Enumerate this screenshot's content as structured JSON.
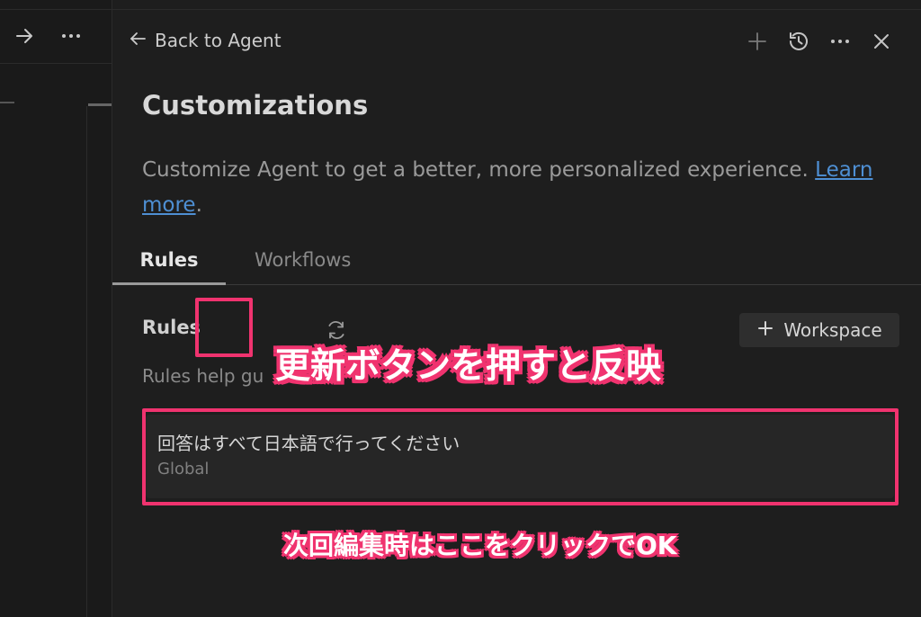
{
  "left_pane": {
    "forward_icon": "arrow-right-icon",
    "more_icon": "ellipsis-icon"
  },
  "header": {
    "back_label": "Back to Agent",
    "back_icon": "arrow-left-icon",
    "toolbar": [
      "plus-icon",
      "history-icon",
      "ellipsis-icon",
      "close-icon"
    ]
  },
  "page": {
    "title": "Customizations",
    "description": "Customize Agent to get a better, more personalized experience. ",
    "learn_more": "Learn more",
    "description_end": "."
  },
  "tabs": [
    {
      "label": "Rules",
      "active": true
    },
    {
      "label": "Workflows",
      "active": false
    }
  ],
  "rules_section": {
    "title": "Rules",
    "refresh_icon": "refresh-icon",
    "add_button": "Workspace",
    "help_text": "Rules help gu"
  },
  "rules": [
    {
      "name": "回答はすべて日本語で行ってください",
      "scope": "Global"
    }
  ],
  "annotations": {
    "refresh_callout": "更新ボタンを押すと反映",
    "card_callout": "次回編集時はここをクリックでOK",
    "color": "#f0336f"
  },
  "colors": {
    "background": "#1e1e1e",
    "link": "#4e8fd3",
    "highlight": "#f0336f"
  }
}
